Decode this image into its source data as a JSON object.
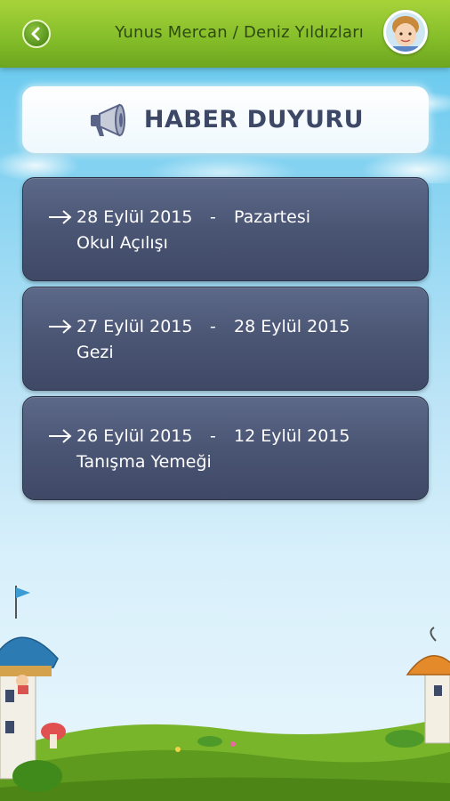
{
  "header": {
    "back_icon": "chevron-left-icon",
    "user_title": "Yunus Mercan / Deniz Yıldızları",
    "avatar_icon": "child-avatar"
  },
  "page": {
    "title": "HABER DUYURU",
    "title_icon": "megaphone-icon"
  },
  "news": [
    {
      "start": "28 Eylül 2015",
      "separator": "-",
      "end": "Pazartesi",
      "title": "Okul Açılışı"
    },
    {
      "start": "27 Eylül 2015",
      "separator": "-",
      "end": "28 Eylül 2015",
      "title": "Gezi"
    },
    {
      "start": "26 Eylül 2015",
      "separator": "-",
      "end": "12 Eylül 2015",
      "title": "Tanışma Yemeği"
    }
  ],
  "colors": {
    "topbar": "#86bf2a",
    "card": "#4a5574",
    "title_text": "#3d4766"
  }
}
